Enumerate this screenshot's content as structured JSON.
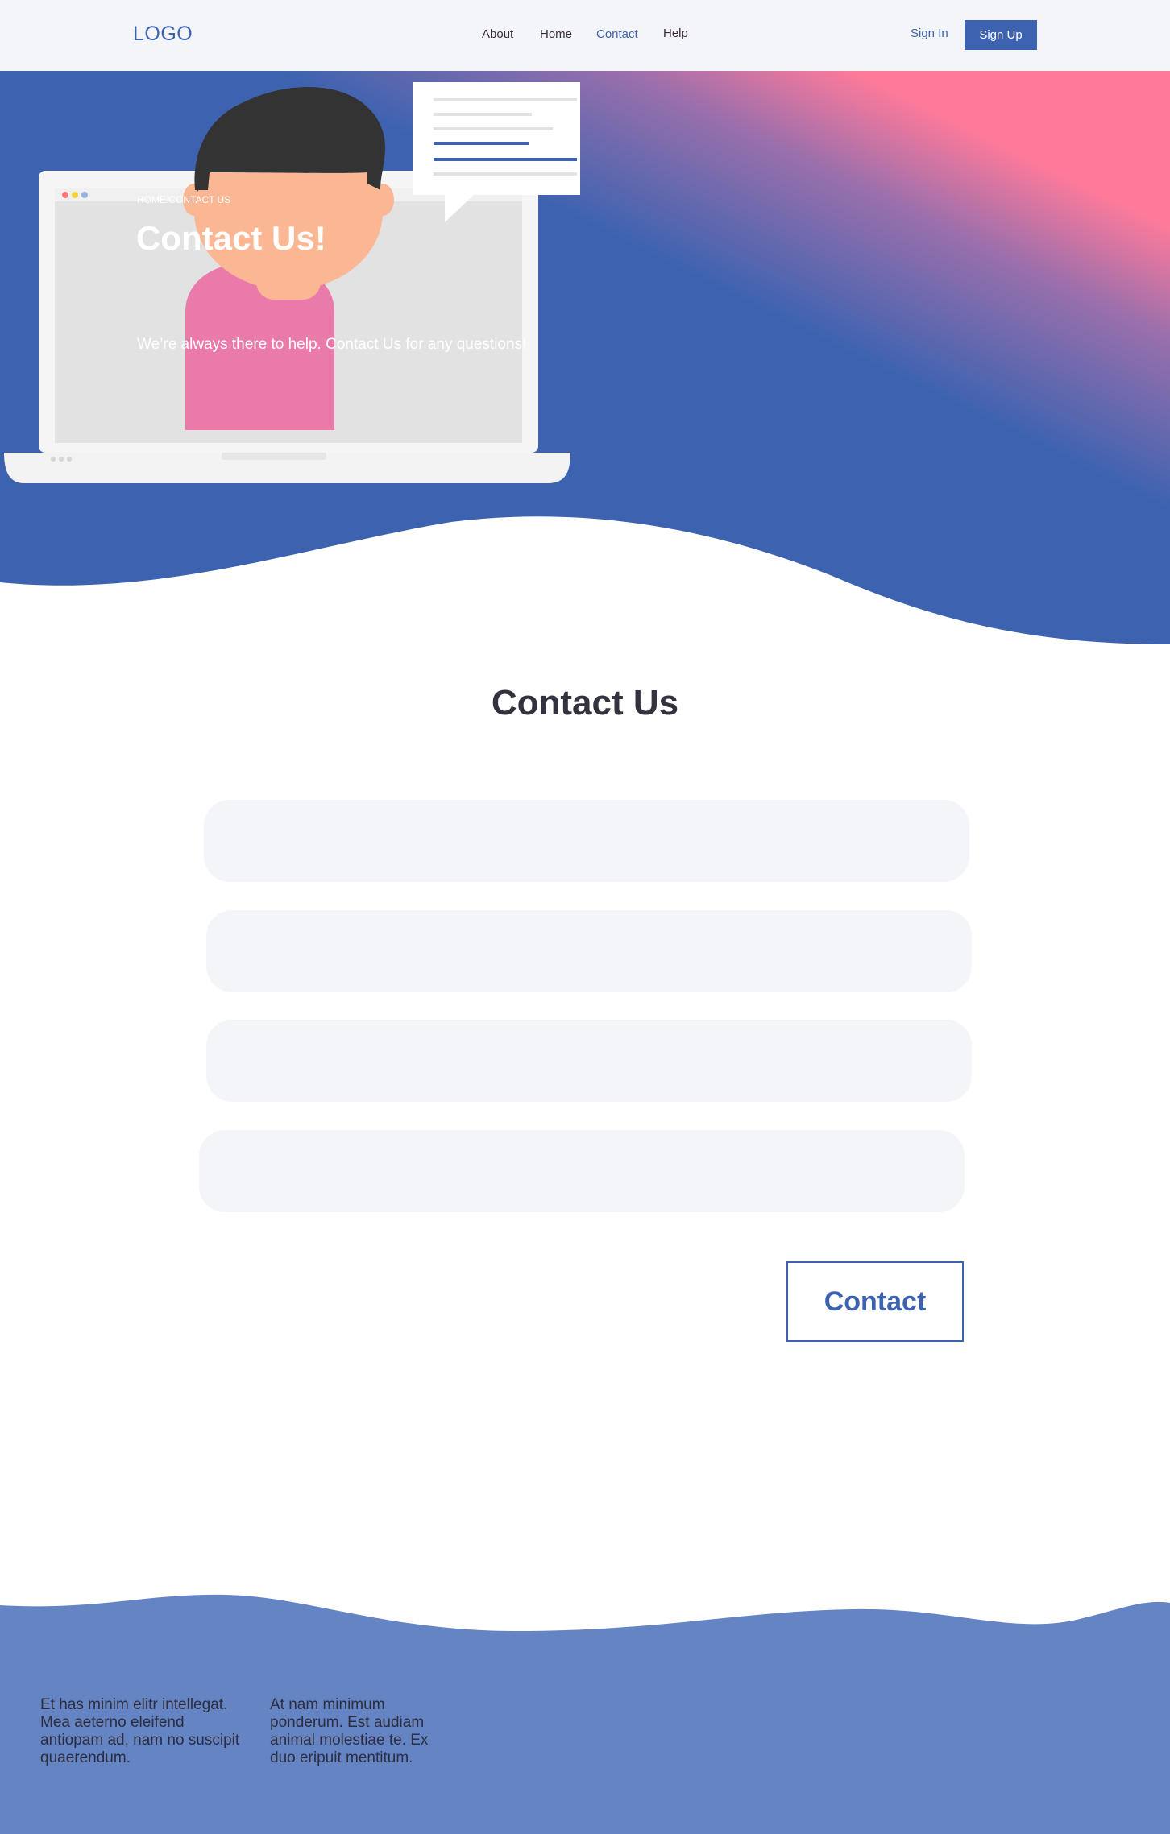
{
  "header": {
    "logo": "LOGO",
    "nav": [
      {
        "label": "About"
      },
      {
        "label": "Home"
      },
      {
        "label": "Contact"
      },
      {
        "label": "Help"
      }
    ],
    "sign_in": "Sign In",
    "sign_up": "Sign Up"
  },
  "hero": {
    "breadcrumb": "HOME/CONTACT US",
    "title": "Contact Us!",
    "subtitle": "We’re always there to help. Contact Us for any questions!",
    "illustration_icon": "person-laptop-illustration"
  },
  "contact": {
    "title": "Contact Us",
    "fields": [
      {
        "value": "",
        "placeholder": ""
      },
      {
        "value": "",
        "placeholder": ""
      },
      {
        "value": "",
        "placeholder": ""
      },
      {
        "value": "",
        "placeholder": ""
      }
    ],
    "button_label": "Contact"
  },
  "footer": {
    "col1": "Et has minim elitr intellegat. Mea aeterno eleifend antiopam ad, nam no suscipit quaerendum.",
    "col2": "At nam minimum ponderum. Est audiam animal molestiae te. Ex duo eripuit mentitum."
  },
  "colors": {
    "brand": "#3d63b0",
    "accent_pink": "#ff7a9a",
    "footer_bg": "#6584c4",
    "field_bg": "#f4f5f9"
  }
}
